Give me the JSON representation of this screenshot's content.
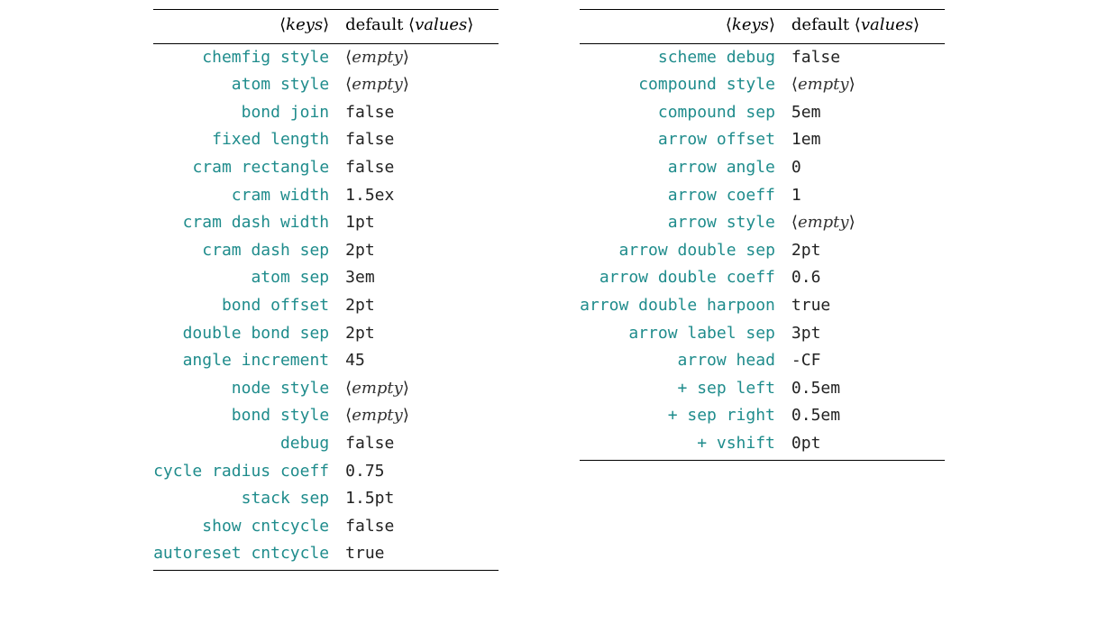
{
  "headers": {
    "keys_label": "keys",
    "values_label": "values",
    "default_word": "default",
    "langle": "⟨",
    "rangle": "⟩"
  },
  "empty_token": "empty",
  "left_table": [
    {
      "key": "chemfig style",
      "value": "",
      "empty": true
    },
    {
      "key": "atom style",
      "value": "",
      "empty": true
    },
    {
      "key": "bond join",
      "value": "false"
    },
    {
      "key": "fixed length",
      "value": "false"
    },
    {
      "key": "cram rectangle",
      "value": "false"
    },
    {
      "key": "cram width",
      "value": "1.5ex"
    },
    {
      "key": "cram dash width",
      "value": "1pt"
    },
    {
      "key": "cram dash sep",
      "value": "2pt"
    },
    {
      "key": "atom sep",
      "value": "3em"
    },
    {
      "key": "bond offset",
      "value": "2pt"
    },
    {
      "key": "double bond sep",
      "value": "2pt"
    },
    {
      "key": "angle increment",
      "value": "45"
    },
    {
      "key": "node style",
      "value": "",
      "empty": true
    },
    {
      "key": "bond style",
      "value": "",
      "empty": true
    },
    {
      "key": "debug",
      "value": "false"
    },
    {
      "key": "cycle radius coeff",
      "value": "0.75"
    },
    {
      "key": "stack sep",
      "value": "1.5pt"
    },
    {
      "key": "show cntcycle",
      "value": "false"
    },
    {
      "key": "autoreset cntcycle",
      "value": "true"
    }
  ],
  "right_table": [
    {
      "key": "scheme debug",
      "value": "false"
    },
    {
      "key": "compound style",
      "value": "",
      "empty": true
    },
    {
      "key": "compound sep",
      "value": "5em"
    },
    {
      "key": "arrow offset",
      "value": "1em"
    },
    {
      "key": "arrow angle",
      "value": "0"
    },
    {
      "key": "arrow coeff",
      "value": "1"
    },
    {
      "key": "arrow style",
      "value": "",
      "empty": true
    },
    {
      "key": "arrow double sep",
      "value": "2pt"
    },
    {
      "key": "arrow double coeff",
      "value": "0.6"
    },
    {
      "key": "arrow double harpoon",
      "value": "true"
    },
    {
      "key": "arrow label sep",
      "value": "3pt"
    },
    {
      "key": "arrow head",
      "value": "-CF"
    },
    {
      "key": "+ sep left",
      "value": "0.5em"
    },
    {
      "key": "+ sep right",
      "value": "0.5em"
    },
    {
      "key": "+ vshift",
      "value": "0pt"
    }
  ]
}
